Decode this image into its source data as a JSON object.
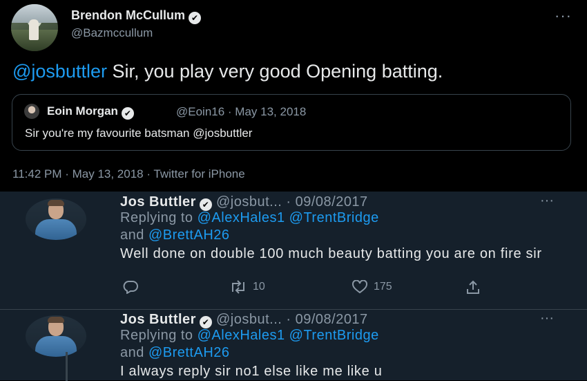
{
  "top_tweet": {
    "author_name": "Brendon McCullum",
    "verified_mark": "✔",
    "handle": "@Bazmccullum",
    "more": "···",
    "mention": "@josbuttler",
    "text": " Sir, you play very good Opening batting.",
    "timestamp": "11:42 PM · May 13, 2018 · Twitter for iPhone",
    "quoted": {
      "author_name": "Eoin Morgan",
      "meta": "@Eoin16 · May 13, 2018",
      "text": "Sir you're my favourite batsman @josbuttler"
    }
  },
  "replies": [
    {
      "author_name": "Jos Buttler",
      "meta": "@josbut... · 09/08/2017",
      "more": "···",
      "replying_prefix": "Replying to ",
      "replying_to": "@AlexHales1 @TrentBridge",
      "replying_and": "and ",
      "replying_to_2": "@BrettAH26",
      "text": "Well done on double 100 much beauty batting you are on fire sir",
      "retweets": "10",
      "likes": "175"
    },
    {
      "author_name": "Jos Buttler",
      "meta": "@josbut... · 09/08/2017",
      "more": "···",
      "replying_prefix": "Replying to ",
      "replying_to": "@AlexHales1 @TrentBridge",
      "replying_and": "and ",
      "replying_to_2": "@BrettAH26",
      "text": "I always reply sir no1 else like me like u"
    }
  ],
  "colors": {
    "background_top": "#000000",
    "background_replies": "#15202b",
    "link": "#1d9bf0",
    "muted": "#8b98a5",
    "text": "#e7e9ea"
  }
}
